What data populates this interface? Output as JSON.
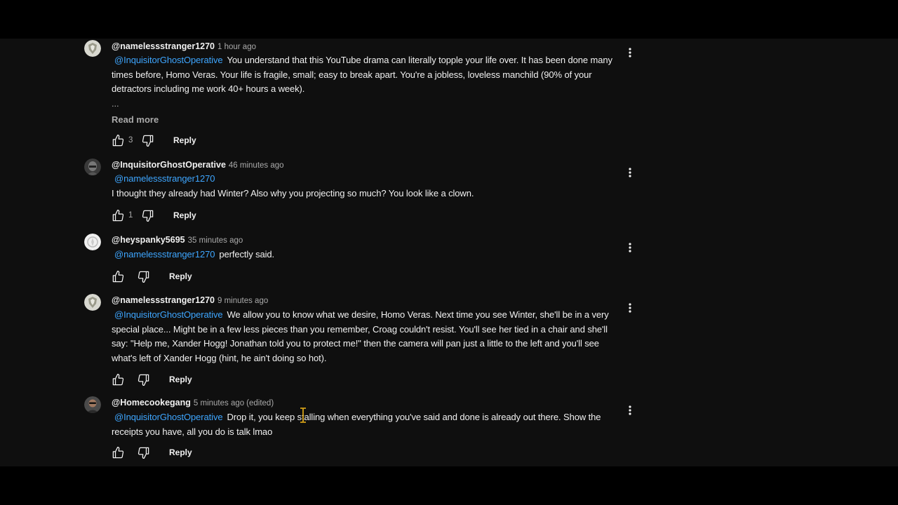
{
  "comments": [
    {
      "author": "@namelessstranger1270",
      "time": "1 hour ago",
      "mention": "@InquisitorGhostOperative",
      "text": "You understand that this YouTube drama can literally topple your life over. It has been done many times before, Homo Veras. Your life is fragile, small; easy to break apart. You're a jobless, loveless manchild (90% of your detractors including me work 40+ hours a week).",
      "ellipsis": "...",
      "read_more": "Read more",
      "likes": "3",
      "reply_label": "Reply",
      "avatar": "shield-emblem-avatar"
    },
    {
      "author": "@InquisitorGhostOperative",
      "time": "46 minutes ago",
      "mention": "@namelessstranger1270",
      "text": "I thought they already had Winter? Also why you projecting so much? You look like a clown.",
      "likes": "1",
      "reply_label": "Reply",
      "avatar": "helmet-avatar"
    },
    {
      "author": "@heyspanky5695",
      "time": "35 minutes ago",
      "mention": "@namelessstranger1270",
      "text": "perfectly said.",
      "likes": "",
      "reply_label": "Reply",
      "avatar": "white-emblem-avatar"
    },
    {
      "author": "@namelessstranger1270",
      "time": "9 minutes ago",
      "mention": "@InquisitorGhostOperative",
      "text": "We allow you to know what we desire, Homo Veras. Next time you see Winter, she'll be in a very special place... Might be in a few less pieces than you remember, Croag couldn't resist. You'll see her tied in a chair and she'll say: \"Help me, Xander Hogg! Jonathan told you to protect me!\" then the camera will pan just a little to the left and you'll see what's left of Xander Hogg (hint, he ain't doing so hot).",
      "likes": "",
      "reply_label": "Reply",
      "avatar": "shield-emblem-avatar"
    },
    {
      "author": "@Homecookegang",
      "time": "5 minutes ago",
      "edited": "(edited)",
      "mention": "@InquisitorGhostOperative",
      "text": "Drop it, you keep stalling when everything you've said and done is already out there. Show the receipts you have, all you do is talk lmao",
      "likes": "",
      "reply_label": "Reply",
      "avatar": "person-sunglasses-avatar"
    }
  ],
  "icons": {
    "like": "thumbs-up-icon",
    "dislike": "thumbs-down-icon",
    "menu": "more-vertical-icon",
    "cursor": "text-cursor-icon"
  },
  "colors": {
    "background": "#0f0f0f",
    "mention": "#3ea6ff",
    "secondary_text": "#aaaaaa",
    "primary_text": "#f1f1f1",
    "cursor": "#d4a017"
  }
}
